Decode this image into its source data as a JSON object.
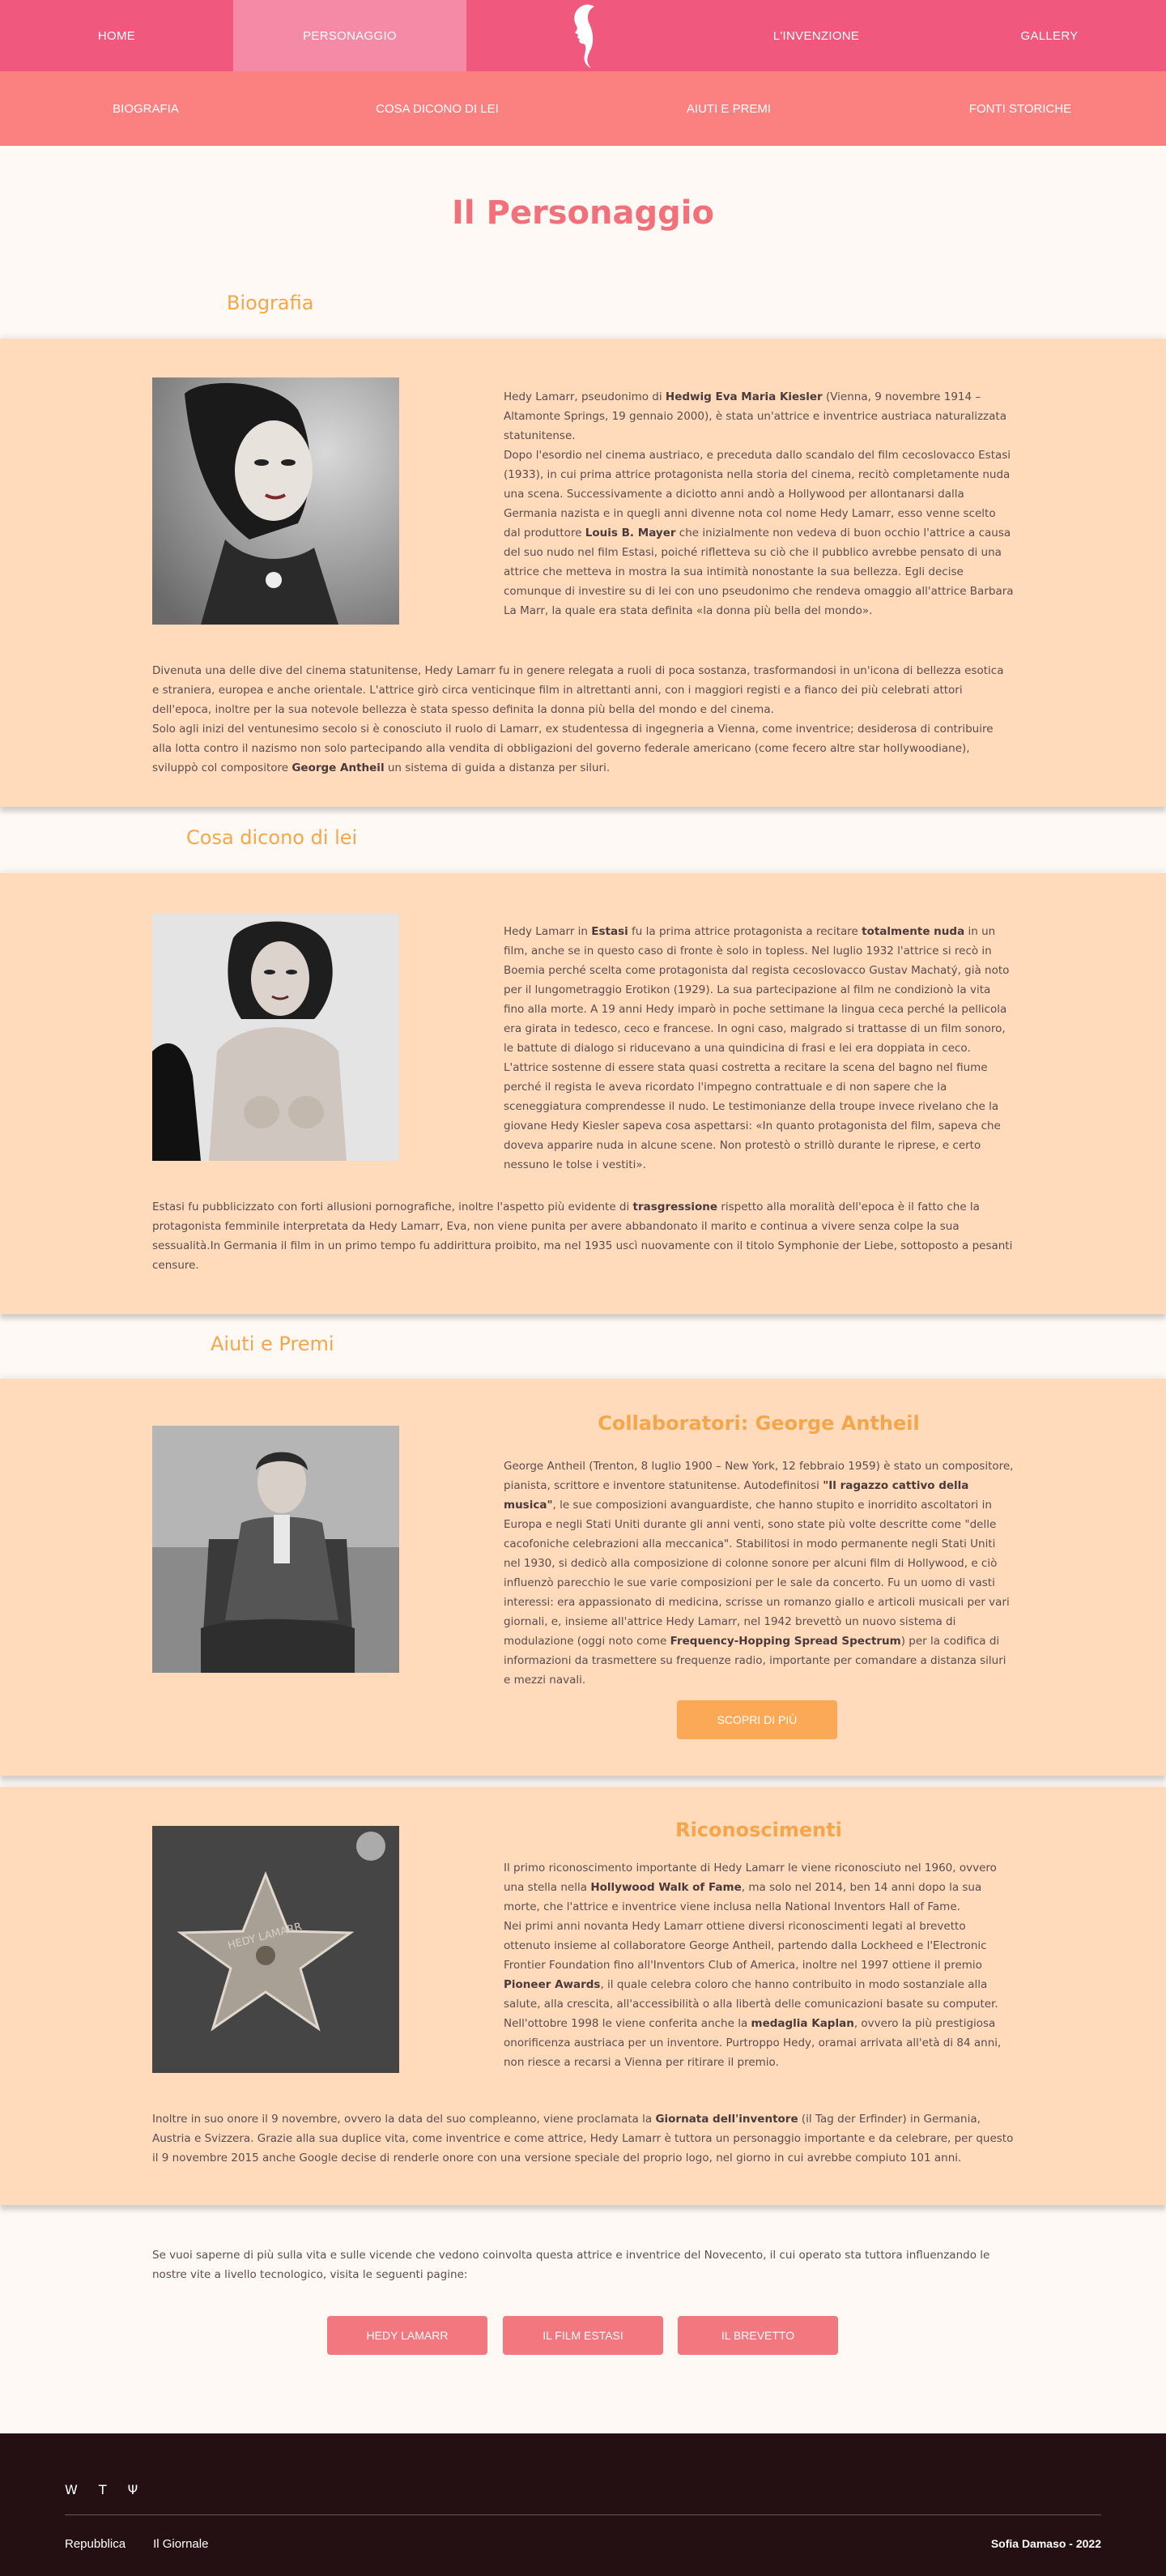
{
  "topnav": {
    "items": [
      "HOME",
      "PERSONAGGIO",
      "L'INVENZIONE",
      "GALLERY"
    ],
    "active": "PERSONAGGIO"
  },
  "subnav": {
    "items": [
      "BIOGRAFIA",
      "COSA DICONO DI LEI",
      "AIUTI E PREMI",
      "FONTI STORICHE"
    ]
  },
  "page_title": "Il Personaggio",
  "sections": {
    "biografia": {
      "heading": "Biografia",
      "p1": [
        "Hedy Lamarr, pseudonimo di ",
        "Hedwig Eva Maria Kiesler",
        " (Vienna, 9 novembre 1914 – Altamonte Springs, 19 gennaio 2000), è stata un'attrice e inventrice austriaca naturalizzata statunitense.",
        "Dopo l'esordio nel cinema austriaco, e preceduta dallo scandalo del film cecoslovacco Estasi (1933), in cui prima attrice protagonista nella storia del cinema, recitò completamente nuda una scena. Successivamente a diciotto anni andò a Hollywood per allontanarsi dalla Germania nazista e in quegli anni divenne nota col nome Hedy Lamarr, esso venne scelto dal produttore ",
        "Louis B. Mayer",
        " che inizialmente non vedeva di buon occhio l'attrice a causa del suo nudo nel film Estasi, poiché rifletteva su ciò che il pubblico avrebbe pensato di una attrice che metteva in mostra la sua intimità nonostante la sua bellezza. Egli decise comunque di investire su di lei con uno pseudonimo che rendeva omaggio all'attrice Barbara La Marr, la quale era stata definita «la donna più bella del mondo»."
      ],
      "p2": [
        "Divenuta una delle dive del cinema statunitense, Hedy Lamarr fu in genere relegata a ruoli di poca sostanza, trasformandosi in un'icona di bellezza esotica e straniera, europea e anche orientale. L'attrice girò circa venticinque film in altrettanti anni, con i maggiori registi e a fianco dei più celebrati attori dell'epoca, inoltre per la sua notevole bellezza è stata spesso definita la donna più bella del mondo e del cinema.",
        "Solo agli inizi del ventunesimo secolo si è conosciuto il ruolo di Lamarr, ex studentessa di ingegneria a Vienna, come inventrice; desiderosa di contribuire alla lotta contro il nazismo non solo partecipando alla vendita di obbligazioni del governo federale americano (come fecero altre star hollywoodiane), sviluppò col compositore ",
        "George Antheil",
        " un sistema di guida a distanza per siluri."
      ]
    },
    "cosa_dicono": {
      "heading": "Cosa dicono di lei",
      "p1": [
        "Hedy Lamarr in ",
        "Estasi",
        " fu la prima attrice protagonista a recitare ",
        "totalmente nuda",
        " in un film, anche se in questo caso di fronte è solo in topless. Nel luglio 1932 l'attrice si recò in Boemia perché scelta come protagonista dal regista cecoslovacco Gustav Machatý, già noto per il lungometraggio Erotikon (1929). La sua partecipazione al film ne condizionò la vita fino alla morte. A 19 anni Hedy imparò in poche settimane la lingua ceca perché la pellicola era girata in tedesco, ceco e francese. In ogni caso, malgrado si trattasse di un film sonoro, le battute di dialogo si riducevano a una quindicina di frasi e lei era doppiata in ceco. L'attrice sostenne di essere stata quasi costretta a recitare la scena del bagno nel fiume perché il regista le aveva ricordato l'impegno contrattuale e di non sapere che la sceneggiatura comprendesse il nudo. Le testimonianze della troupe invece rivelano che la giovane Hedy Kiesler sapeva cosa aspettarsi: «In quanto protagonista del film, sapeva che doveva apparire nuda in alcune scene. Non protestò o strillò durante le riprese, e certo nessuno le tolse i vestiti»."
      ],
      "p2": [
        "Estasi fu pubblicizzato con forti allusioni pornografiche, inoltre l'aspetto più evidente di ",
        "trasgressione",
        " rispetto alla moralità dell'epoca è il fatto che la protagonista femminile interpretata da Hedy Lamarr, Eva, non viene punita per avere abbandonato il marito e continua a vivere senza colpe la sua sessualità.In Germania il film in un primo tempo fu addirittura proibito, ma nel 1935 uscì nuovamente con il titolo Symphonie der Liebe, sottoposto a pesanti censure."
      ]
    },
    "aiuti": {
      "heading": "Aiuti e Premi",
      "collab_title": "Collaboratori: George Antheil",
      "collab_text": [
        "George Antheil (Trenton, 8 luglio 1900 – New York, 12 febbraio 1959) è stato un compositore, pianista, scrittore e inventore statunitense. Autodefinitosi ",
        "\"Il ragazzo cattivo della musica\"",
        ", le sue composizioni avanguardiste, che hanno stupito e inorridito ascoltatori in Europa e negli Stati Uniti durante gli anni venti, sono state più volte descritte come \"delle cacofoniche celebrazioni alla meccanica\". Stabilitosi in modo permanente negli Stati Uniti nel 1930, si dedicò alla composizione di colonne sonore per alcuni film di Hollywood, e ciò influenzò parecchio le sue varie composizioni per le sale da concerto. Fu un uomo di vasti interessi: era appassionato di medicina, scrisse un romanzo giallo e articoli musicali per vari giornali, e, insieme all'attrice Hedy Lamarr, nel 1942 brevettò un nuovo sistema di modulazione (oggi noto come ",
        "Frequency-Hopping Spread Spectrum",
        ") per la codifica di informazioni da trasmettere su frequenze radio, importante per comandare a distanza siluri e mezzi navali."
      ],
      "button": "SCOPRI DI PIÙ"
    },
    "riconoscimenti": {
      "title": "Riconoscimenti",
      "p1": [
        "Il primo riconoscimento importante di Hedy Lamarr le viene riconosciuto nel 1960, ovvero una stella nella ",
        "Hollywood Walk of Fame",
        ", ma solo nel 2014, ben 14 anni dopo la sua morte, che l'attrice e inventrice viene inclusa nella National Inventors Hall of Fame.",
        "Nei primi anni novanta Hedy Lamarr ottiene diversi riconoscimenti legati al brevetto ottenuto insieme al collaboratore George Antheil, partendo dalla Lockheed e l'Electronic Frontier Foundation fino all'Inventors Club of America, inoltre nel 1997 ottiene il premio ",
        "Pioneer Awards",
        ", il quale celebra coloro che hanno contribuito in modo sostanziale alla salute, alla crescita, all'accessibilità o alla libertà delle comunicazioni basate su computer. Nell'ottobre 1998 le viene conferita anche la ",
        "medaglia Kaplan",
        ", ovvero la più prestigiosa onorificenza austriaca per un inventore. Purtroppo Hedy, oramai arrivata all'età di 84 anni, non riesce a recarsi a Vienna per ritirare il premio."
      ],
      "p2": [
        "Inoltre in suo onore il 9 novembre, ovvero la data del suo compleanno, viene proclamata la ",
        "Giornata dell'inventore",
        " (il Tag der Erfinder) in Germania, Austria e Svizzera. Grazie alla sua duplice vita, come inventrice e come attrice, Hedy Lamarr è tuttora un personaggio importante e da celebrare, per questo il 9 novembre 2015 anche Google decise di renderle onore con una versione speciale del proprio logo, nel giorno in cui avrebbe compiuto 101 anni."
      ],
      "star_text": "HEDY LAMARR"
    },
    "fonti": {
      "text": "Se vuoi saperne di più sulla vita e sulle vicende che vedono coinvolta questa attrice e inventrice del Novecento, il cui operato sta tuttora influenzando le nostre vite a livello tecnologico, visita le seguenti pagine:",
      "buttons": [
        "HEDY LAMARR",
        "IL FILM ESTASI",
        "IL BREVETTO"
      ]
    }
  },
  "footer": {
    "icons": [
      "W",
      "T",
      "Ψ"
    ],
    "links": [
      "Repubblica",
      "Il Giornale"
    ],
    "credit": "Sofia Damaso - 2022"
  }
}
